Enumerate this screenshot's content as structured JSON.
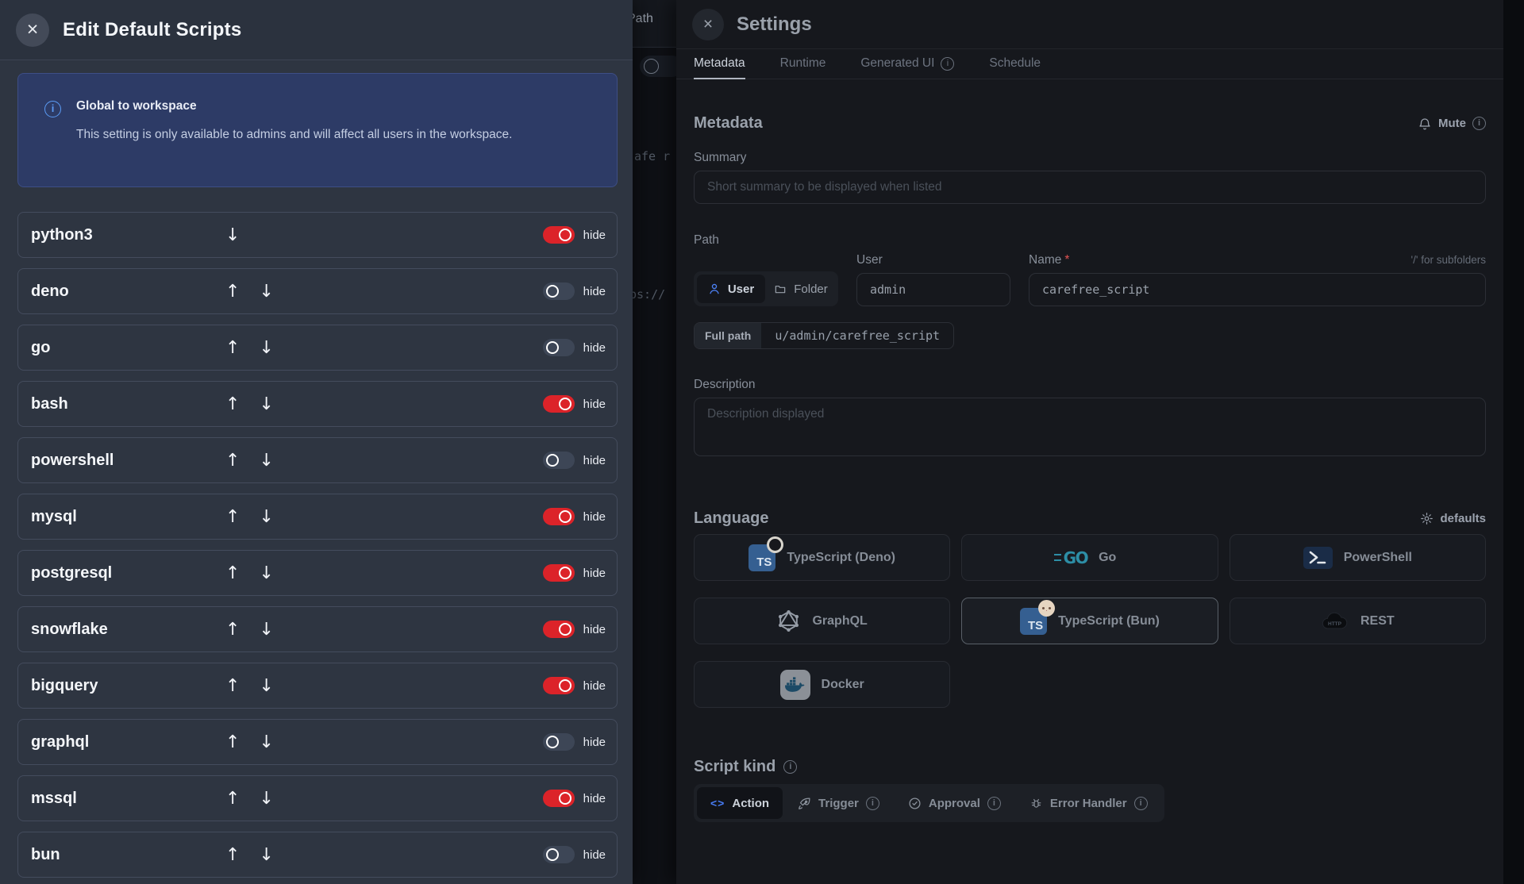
{
  "left_panel": {
    "title": "Edit Default Scripts",
    "close_glyph": "×",
    "info": {
      "title": "Global to workspace",
      "body": "This setting is only available to admins and will affect all users in the workspace."
    },
    "hide_label": "hide",
    "up_glyph": "↑",
    "down_glyph": "↓",
    "rows": [
      {
        "name": "python3",
        "up": false,
        "down": true,
        "hidden_on": true
      },
      {
        "name": "deno",
        "up": true,
        "down": true,
        "hidden_on": false
      },
      {
        "name": "go",
        "up": true,
        "down": true,
        "hidden_on": false
      },
      {
        "name": "bash",
        "up": true,
        "down": true,
        "hidden_on": true
      },
      {
        "name": "powershell",
        "up": true,
        "down": true,
        "hidden_on": false
      },
      {
        "name": "mysql",
        "up": true,
        "down": true,
        "hidden_on": true
      },
      {
        "name": "postgresql",
        "up": true,
        "down": true,
        "hidden_on": true
      },
      {
        "name": "snowflake",
        "up": true,
        "down": true,
        "hidden_on": true
      },
      {
        "name": "bigquery",
        "up": true,
        "down": true,
        "hidden_on": true
      },
      {
        "name": "graphql",
        "up": true,
        "down": true,
        "hidden_on": false
      },
      {
        "name": "mssql",
        "up": true,
        "down": true,
        "hidden_on": true
      },
      {
        "name": "bun",
        "up": true,
        "down": true,
        "hidden_on": false
      }
    ]
  },
  "background": {
    "path_label": "Path",
    "code_fragment_1": "afe r",
    "code_fragment_2": "ps://"
  },
  "settings": {
    "title": "Settings",
    "close_glyph": "×",
    "tabs": [
      {
        "label": "Metadata",
        "active": true,
        "info": false
      },
      {
        "label": "Runtime",
        "active": false,
        "info": false
      },
      {
        "label": "Generated UI",
        "active": false,
        "info": true
      },
      {
        "label": "Schedule",
        "active": false,
        "info": false
      }
    ],
    "mute_label": "Mute",
    "metadata_heading": "Metadata",
    "summary": {
      "label": "Summary",
      "placeholder": "Short summary to be displayed when listed"
    },
    "path": {
      "label": "Path",
      "owner_options": [
        {
          "label": "User",
          "icon": "user-icon",
          "active": true
        },
        {
          "label": "Folder",
          "icon": "folder-icon",
          "active": false
        }
      ],
      "user_label": "User",
      "user_value": "admin",
      "name_label": "Name",
      "name_required_glyph": "*",
      "name_value": "carefree_script",
      "subfolder_hint": "'/' for subfolders",
      "full_path_label": "Full path",
      "full_path_value": "u/admin/carefree_script"
    },
    "description": {
      "label": "Description",
      "placeholder": "Description displayed"
    },
    "language": {
      "heading": "Language",
      "defaults_label": "defaults",
      "options": [
        {
          "label": "TypeScript (Deno)",
          "icon": "typescript-deno-icon",
          "selected": false
        },
        {
          "label": "Go",
          "icon": "go-icon",
          "selected": false
        },
        {
          "label": "PowerShell",
          "icon": "powershell-icon",
          "selected": false
        },
        {
          "label": "GraphQL",
          "icon": "graphql-icon",
          "selected": false
        },
        {
          "label": "TypeScript (Bun)",
          "icon": "typescript-bun-icon",
          "selected": true
        },
        {
          "label": "REST",
          "icon": "rest-icon",
          "selected": false
        },
        {
          "label": "Docker",
          "icon": "docker-icon",
          "selected": false
        }
      ]
    },
    "script_kind": {
      "heading": "Script kind",
      "options": [
        {
          "label": "Action",
          "icon": "code-icon",
          "active": true,
          "info": false
        },
        {
          "label": "Trigger",
          "icon": "rocket-icon",
          "active": false,
          "info": true
        },
        {
          "label": "Approval",
          "icon": "check-circle-icon",
          "active": false,
          "info": true
        },
        {
          "label": "Error Handler",
          "icon": "bug-icon",
          "active": false,
          "info": true
        }
      ]
    }
  },
  "colors": {
    "accent_blue": "#4d82f8",
    "toggle_on_red": "#dc2329",
    "toggle_off_slate": "#3d4656",
    "left_panel_bg": "#2e3541",
    "info_banner_bg": "#2d3b66",
    "drawer_bg": "#16181d"
  }
}
